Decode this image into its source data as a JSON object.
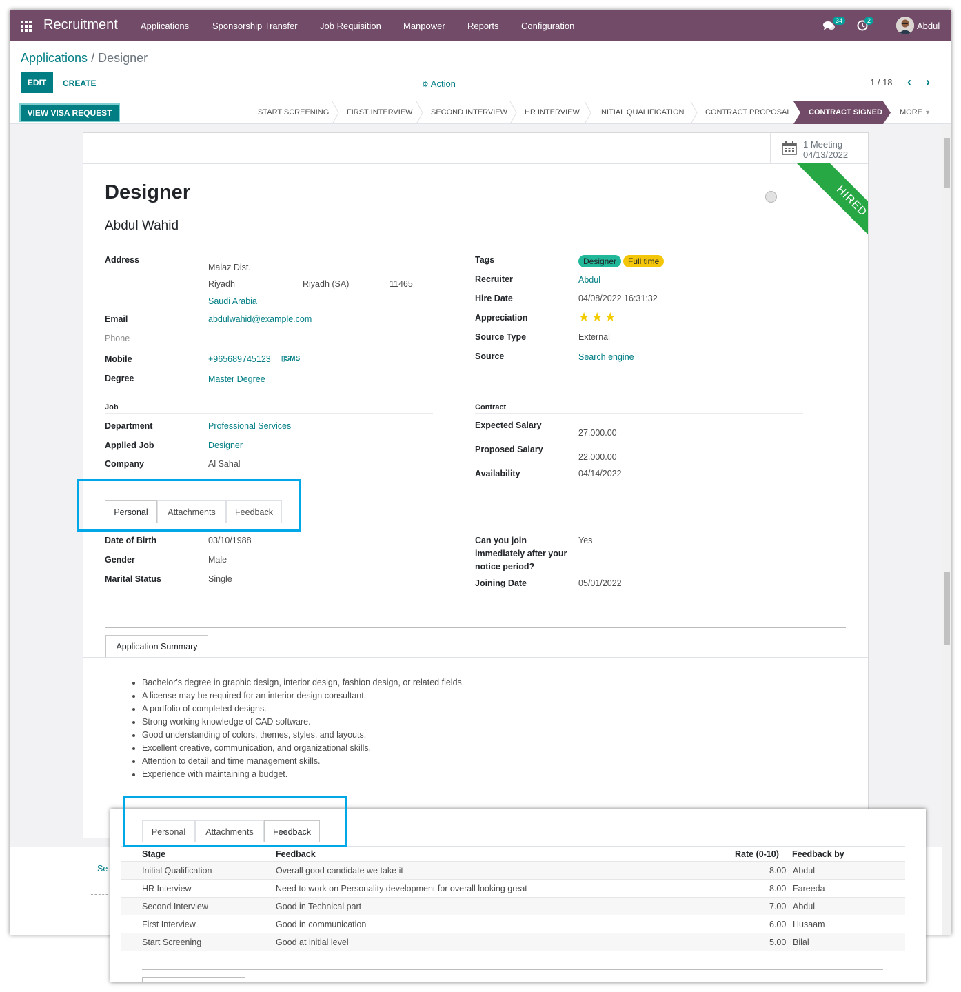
{
  "navbar": {
    "app_name": "Recruitment",
    "menu": [
      "Applications",
      "Sponsorship Transfer",
      "Job Requisition",
      "Manpower",
      "Reports",
      "Configuration"
    ],
    "messages_count": "34",
    "activities_count": "2",
    "user": "Abdul",
    "icons": [
      "apps-grid-icon",
      "chat-icon",
      "clock-icon",
      "avatar"
    ]
  },
  "control": {
    "breadcrumb_parent": "Applications",
    "breadcrumb_sep": "/",
    "breadcrumb_current": "Designer",
    "edit_label": "EDIT",
    "create_label": "CREATE",
    "action_label": "Action",
    "pager": "1 / 18"
  },
  "statusbar": {
    "visa_button": "VIEW VISA REQUEST",
    "stages": [
      "START SCREENING",
      "FIRST INTERVIEW",
      "SECOND INTERVIEW",
      "HR INTERVIEW",
      "INITIAL QUALIFICATION",
      "CONTRACT PROPOSAL"
    ],
    "active_stage": "CONTRACT SIGNED",
    "more_label": "MORE"
  },
  "sheet": {
    "meeting_count": "1 Meeting",
    "meeting_date": "04/13/2022",
    "ribbon": "HIRED",
    "title": "Designer",
    "applicant": "Abdul Wahid",
    "left": {
      "address_label": "Address",
      "street": "Malaz Dist.",
      "city": "Riyadh",
      "state": "Riyadh (SA)",
      "zip": "11465",
      "country": "Saudi Arabia",
      "email_label": "Email",
      "email": "abdulwahid@example.com",
      "phone_label": "Phone",
      "mobile_label": "Mobile",
      "mobile": "+965689745123",
      "sms": "SMS",
      "degree_label": "Degree",
      "degree": "Master Degree",
      "job_section": "Job",
      "department_label": "Department",
      "department": "Professional Services",
      "applied_job_label": "Applied Job",
      "applied_job": "Designer",
      "company_label": "Company",
      "company": "Al Sahal"
    },
    "right": {
      "tags_label": "Tags",
      "tag1": "Designer",
      "tag2": "Full time",
      "recruiter_label": "Recruiter",
      "recruiter": "Abdul",
      "hire_date_label": "Hire Date",
      "hire_date": "04/08/2022 16:31:32",
      "appreciation_label": "Appreciation",
      "appreciation_stars": 3,
      "stars_text": "★★★",
      "source_type_label": "Source Type",
      "source_type": "External",
      "source_label": "Source",
      "source": "Search engine",
      "contract_section": "Contract",
      "expected_salary_label": "Expected Salary",
      "expected_salary": "27,000.00",
      "proposed_salary_label": "Proposed Salary",
      "proposed_salary": "22,000.00",
      "availability_label": "Availability",
      "availability": "04/14/2022"
    },
    "tabs": [
      "Personal",
      "Attachments",
      "Feedback"
    ],
    "personal": {
      "dob_label": "Date of Birth",
      "dob": "03/10/1988",
      "gender_label": "Gender",
      "gender": "Male",
      "marital_label": "Marital Status",
      "marital": "Single",
      "join_q1": "Can you join",
      "join_q2": "immediately after your",
      "join_q3": "notice period?",
      "join_answer": "Yes",
      "joining_date_label": "Joining Date",
      "joining_date": "05/01/2022"
    },
    "summary_tab": "Application Summary",
    "summary": [
      "Bachelor's degree in graphic design, interior design, fashion design, or related fields.",
      "A license may be required for an interior design consultant.",
      "A portfolio of completed designs.",
      "Strong working knowledge of CAD software.",
      "Good understanding of colors, themes, styles, and layouts.",
      "Excellent creative, communication, and organizational skills.",
      "Attention to detail and time management skills.",
      "Experience with maintaining a budget."
    ]
  },
  "chatter": {
    "send_partial": "Se"
  },
  "feedback_overlay": {
    "tabs": [
      "Personal",
      "Attachments",
      "Feedback"
    ],
    "headers": [
      "Stage",
      "Feedback",
      "Rate (0-10)",
      "Feedback by"
    ],
    "rows": [
      [
        "Initial Qualification",
        "Overall good candidate we take it",
        "8.00",
        "Abdul"
      ],
      [
        "HR Interview",
        "Need to work on Personality development for overall looking great",
        "8.00",
        "Fareeda"
      ],
      [
        "Second Interview",
        "Good in Technical part",
        "7.00",
        "Abdul"
      ],
      [
        "First Interview",
        "Good in communication",
        "6.00",
        "Husaam"
      ],
      [
        "Start Screening",
        "Good at initial level",
        "5.00",
        "Bilal"
      ]
    ]
  },
  "colors": {
    "brand": "#714b67",
    "accent": "#017e84",
    "hired_ribbon": "#28a745",
    "highlight": "#00a8e8"
  }
}
